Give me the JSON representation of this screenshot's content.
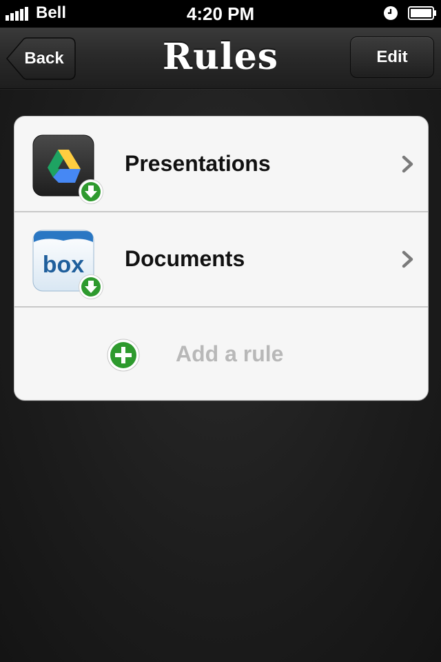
{
  "status_bar": {
    "carrier": "Bell",
    "time": "4:20 PM"
  },
  "nav": {
    "title": "Rules",
    "back_label": "Back",
    "edit_label": "Edit"
  },
  "rules": [
    {
      "label": "Presentations",
      "icon": "google-drive-icon",
      "badge": "download-badge-icon"
    },
    {
      "label": "Documents",
      "icon": "box-icon",
      "badge": "download-badge-icon"
    }
  ],
  "add_rule": {
    "label": "Add a rule",
    "icon": "plus-circle-icon"
  },
  "colors": {
    "accent_green": "#2e9a2e",
    "background": "#1d1d1d",
    "card": "#f6f6f6",
    "add_text": "#b8b8b8"
  }
}
